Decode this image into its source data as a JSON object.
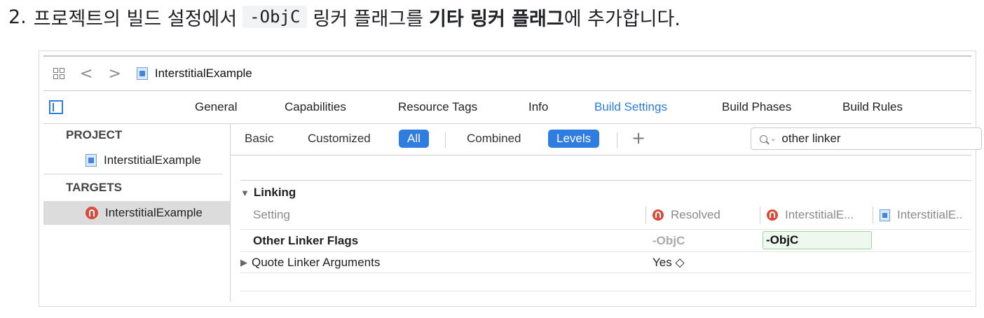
{
  "instruction": {
    "number": "2.",
    "prefix": "프로젝트의 빌드 설정에서",
    "code": "-ObjC",
    "middle": "링커 플래그를",
    "bold": "기타 링커 플래그",
    "suffix": "에 추가합니다."
  },
  "toolbar": {
    "back": "<",
    "forward": ">",
    "project_name": "InterstitialExample"
  },
  "tabs": [
    "General",
    "Capabilities",
    "Resource Tags",
    "Info",
    "Build Settings",
    "Build Phases",
    "Build Rules"
  ],
  "active_tab": "Build Settings",
  "sidebar": {
    "project_header": "PROJECT",
    "project_item": "InterstitialExample",
    "targets_header": "TARGETS",
    "target_item": "InterstitialExample"
  },
  "filter": {
    "basic": "Basic",
    "customized": "Customized",
    "all": "All",
    "combined": "Combined",
    "levels": "Levels",
    "plus": "+",
    "search_value": "other linker"
  },
  "section": {
    "title": "Linking",
    "col_setting": "Setting",
    "col_resolved": "Resolved",
    "col_target": "InterstitialE...",
    "col_project": "InterstitialE.."
  },
  "rows": [
    {
      "name": "Other Linker Flags",
      "resolved": "-ObjC",
      "target_value": "-ObjC"
    },
    {
      "name": "Quote Linker Arguments",
      "resolved": "Yes ◇"
    }
  ],
  "colors": {
    "accent": "#2f7de1",
    "target_icon": "#d94b3a"
  }
}
